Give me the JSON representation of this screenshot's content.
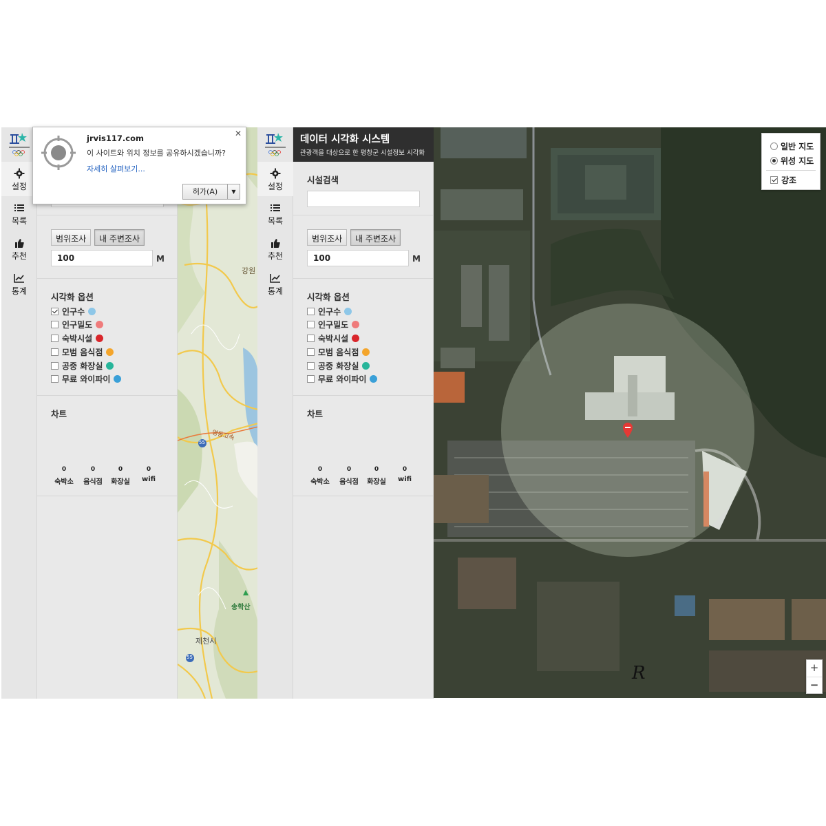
{
  "nav": {
    "items": [
      {
        "label": "설정",
        "icon": "gear-icon"
      },
      {
        "label": "목록",
        "icon": "list-icon"
      },
      {
        "label": "추천",
        "icon": "thumbs-up-icon"
      },
      {
        "label": "통계",
        "icon": "chart-icon"
      }
    ]
  },
  "header": {
    "title": "데이터 시각화 시스템",
    "subtitle": "관광객을 대상으로 한 평창군 시설정보 시각화"
  },
  "search": {
    "label": "시설검색",
    "value": ""
  },
  "survey": {
    "range_button": "범위조사",
    "nearby_button": "내 주변조사",
    "radius_value": "100",
    "unit": "M"
  },
  "visual": {
    "title": "시각화 옵션",
    "options": [
      {
        "label": "인구수",
        "color": "#8ec7e8"
      },
      {
        "label": "인구밀도",
        "color": "#ef7b7b"
      },
      {
        "label": "숙박시설",
        "color": "#d9262b"
      },
      {
        "label": "모범 음식점",
        "color": "#f4a52b"
      },
      {
        "label": "공중 화장실",
        "color": "#27b59a"
      },
      {
        "label": "무료 와이파이",
        "color": "#3aa0d8"
      }
    ],
    "left_checked": [
      true,
      false,
      false,
      false,
      false,
      false
    ],
    "right_checked": [
      false,
      false,
      false,
      false,
      false,
      false
    ]
  },
  "chart": {
    "title": "차트",
    "categories": [
      "숙박소",
      "음식점",
      "화장실",
      "wifi"
    ],
    "values": [
      0,
      0,
      0,
      0
    ]
  },
  "popup": {
    "domain": "jrvis117.com",
    "message": "이 사이트와 위치 정보를 공유하시겠습니까?",
    "more_link": "자세히 살펴보기...",
    "allow_button": "허가(A)",
    "close_icon": "close-icon"
  },
  "roadmap": {
    "labels": [
      "강원",
      "영동고속",
      "송학산",
      "제천시",
      "55",
      "55"
    ]
  },
  "map_type": {
    "options": [
      "일반 지도",
      "위성 지도"
    ],
    "selected": 1,
    "highlight_label": "강조",
    "highlight_checked": true
  },
  "watermark": "R",
  "colors": {
    "header_bg": "#2f2f2f",
    "panel_bg": "#e9e9e9",
    "marker": "#e53935",
    "link": "#1f5fbf"
  }
}
